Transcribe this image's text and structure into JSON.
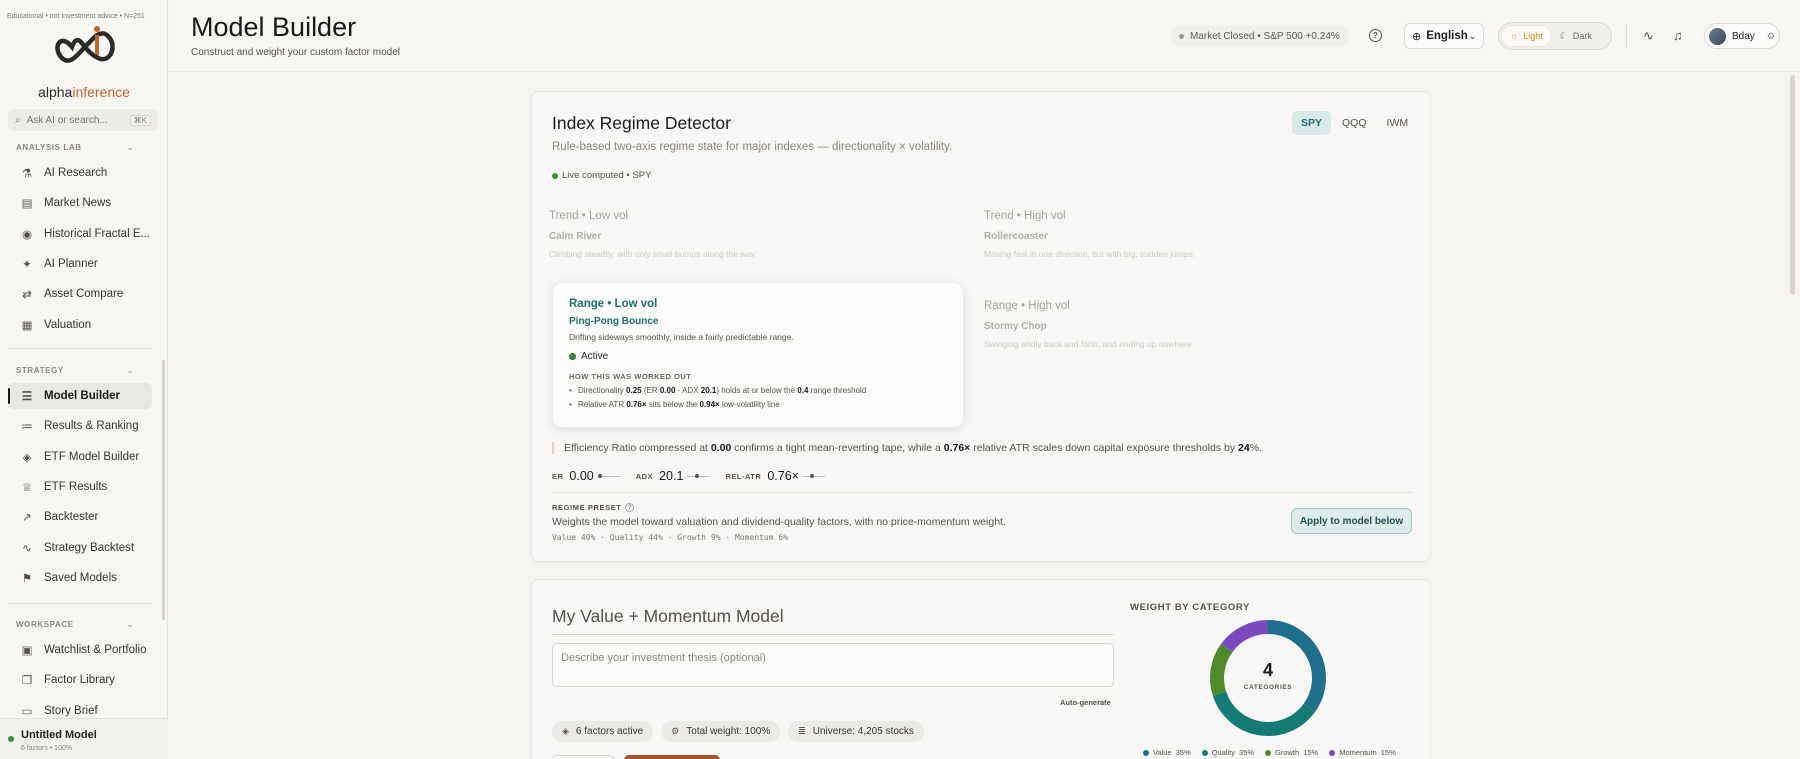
{
  "sidebar": {
    "disclaimer": "Educational • not investment advice • N=251",
    "brand_a": "alpha",
    "brand_b": "inference",
    "search_placeholder": "Ask AI or search...",
    "search_shortcut": "⌘K",
    "sections": {
      "analysis": "ANALYSIS LAB",
      "strategy": "STRATEGY",
      "workspace": "WORKSPACE"
    },
    "analysis_items": [
      {
        "label": "AI Research",
        "icon": "flask-icon"
      },
      {
        "label": "Market News",
        "icon": "newspaper-icon"
      },
      {
        "label": "Historical Fractal E...",
        "icon": "eye-icon"
      },
      {
        "label": "AI Planner",
        "icon": "sparkle-icon"
      },
      {
        "label": "Asset Compare",
        "icon": "compare-icon"
      },
      {
        "label": "Valuation",
        "icon": "calculator-icon"
      }
    ],
    "strategy_items": [
      {
        "label": "Model Builder",
        "icon": "sliders-icon",
        "active": true
      },
      {
        "label": "Results & Ranking",
        "icon": "list-icon"
      },
      {
        "label": "ETF Model Builder",
        "icon": "layers-icon"
      },
      {
        "label": "ETF Results",
        "icon": "trophy-icon"
      },
      {
        "label": "Backtester",
        "icon": "chart-icon"
      },
      {
        "label": "Strategy Backtest",
        "icon": "pulse-icon"
      },
      {
        "label": "Saved Models",
        "icon": "bookmark-icon"
      }
    ],
    "workspace_items": [
      {
        "label": "Watchlist & Portfolio",
        "icon": "briefcase-icon"
      },
      {
        "label": "Factor Library",
        "icon": "book-icon"
      },
      {
        "label": "Story Brief",
        "icon": "document-icon"
      }
    ],
    "footer": {
      "title": "Untitled Model",
      "sub": "6 factors • 100%"
    }
  },
  "header": {
    "title": "Model Builder",
    "subtitle": "Construct and weight your custom factor model",
    "market": "Market Closed • S&P 500 +0.24%",
    "language": "English",
    "theme_light": "Light",
    "theme_dark": "Dark",
    "user": "Bday"
  },
  "regime": {
    "title": "Index Regime Detector",
    "subtitle": "Rule-based two-axis regime state for major indexes — directionality × volatility.",
    "tabs": [
      "SPY",
      "QQQ",
      "IWM"
    ],
    "active_tab": "SPY",
    "live": "Live computed • SPY",
    "quadrants": {
      "tl": {
        "title": "Trend • Low vol",
        "name": "Calm River",
        "desc": "Climbing steadily, with only small bumps along the way."
      },
      "tr": {
        "title": "Trend • High vol",
        "name": "Rollercoaster",
        "desc": "Moving fast in one direction, but with big, sudden jumps."
      },
      "bl": {
        "title": "Range • Low vol",
        "name": "Ping-Pong Bounce",
        "desc": "Drifting sideways smoothly, inside a fairly predictable range.",
        "status": "Active",
        "how_label": "HOW THIS WAS WORKED OUT"
      },
      "br": {
        "title": "Range • High vol",
        "name": "Stormy Chop",
        "desc": "Swinging wildly back and forth, and ending up nowhere."
      }
    },
    "bullet1": {
      "a": "Directionality ",
      "v1": "0.25",
      "b": " (ER ",
      "v2": "0.00",
      "c": " · ADX ",
      "v3": "20.1",
      "d": ") holds at or below the ",
      "v4": "0.4",
      "e": " range threshold"
    },
    "bullet2": {
      "a": "Relative ATR ",
      "v1": "0.76×",
      "b": " sits below the ",
      "v2": "0.94×",
      "c": " low-volatility line"
    },
    "summary": {
      "a": "Efficiency Ratio compressed at ",
      "v1": "0.00",
      "b": " confirms a tight mean-reverting tape, while a ",
      "v2": "0.76×",
      "c": " relative ATR scales down capital exposure thresholds by ",
      "v3": "24",
      "d": "%."
    },
    "metrics": [
      {
        "label": "ER",
        "value": "0.00",
        "level": 0.0
      },
      {
        "label": "ADX",
        "value": "20.1",
        "level": 0.4
      },
      {
        "label": "REL-ATR",
        "value": "0.76×",
        "level": 0.4
      }
    ],
    "preset_label": "REGIME PRESET",
    "preset_desc": "Weights the model toward valuation and dividend-quality factors, with no price-momentum weight.",
    "preset_mix": "Value 40% · Quality 44% · Growth 9% · Momentum 6%",
    "apply_label": "Apply to model below"
  },
  "model": {
    "title": "My Value + Momentum Model",
    "thesis_placeholder": "Describe your investment thesis (optional)",
    "autogen": "Auto-generate",
    "pills": [
      {
        "icon": "layers-icon",
        "label": "6 factors active"
      },
      {
        "icon": "gear-icon",
        "label": "Total weight: 100%"
      },
      {
        "icon": "database-icon",
        "label": "Universe: 4,205 stocks"
      }
    ],
    "weight_title": "WEIGHT BY CATEGORY",
    "center_value": "4",
    "center_label": "CATEGORIES"
  },
  "chart_data": {
    "type": "pie",
    "title": "WEIGHT BY CATEGORY",
    "categories": [
      "Value",
      "Quality",
      "Growth",
      "Momentum"
    ],
    "values": [
      35,
      35,
      15,
      15
    ],
    "colors": [
      "#1f6e8c",
      "#137a76",
      "#4e8a2a",
      "#7a4bbf"
    ],
    "legend": "bottom"
  }
}
